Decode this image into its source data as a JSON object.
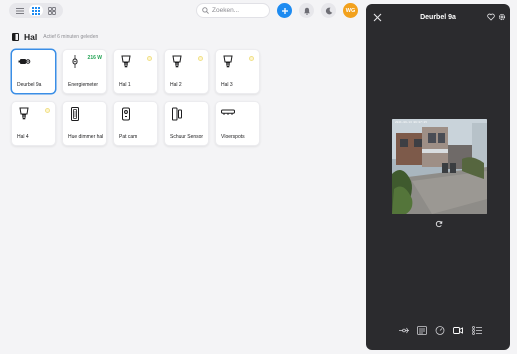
{
  "toolbar": {
    "search_placeholder": "Zoeken...",
    "avatar_initials": "WG",
    "colors": {
      "add": "#1d8bf1",
      "avatar": "#f2a11d"
    }
  },
  "room": {
    "title": "Hal",
    "subtitle": "Actief 6 minuten geleden"
  },
  "devices": [
    {
      "label": "Deurbel 9a",
      "icon": "doorbell-icon",
      "selected": true
    },
    {
      "label": "Energiemeter",
      "icon": "energy-meter-icon",
      "value": "216 W"
    },
    {
      "label": "Hal 1",
      "icon": "bulb-icon"
    },
    {
      "label": "Hal 2",
      "icon": "bulb-icon"
    },
    {
      "label": "Hal 3",
      "icon": "bulb-icon"
    },
    {
      "label": "Hal 4",
      "icon": "bulb-icon"
    },
    {
      "label": "Hue dimmer hal",
      "icon": "dimmer-switch-icon"
    },
    {
      "label": "Pat cam",
      "icon": "camera-device-icon"
    },
    {
      "label": "Schuur Sensor",
      "icon": "contact-sensor-icon"
    },
    {
      "label": "Vloerspots",
      "icon": "ceiling-spots-icon"
    }
  ],
  "panel": {
    "title": "Deurbel 9a",
    "camera_overlay": "2021-09-13 09:07:25",
    "toolbar_icons": [
      "sensor-icon",
      "list-settings-icon",
      "gauge-icon",
      "video-icon",
      "checklist-icon"
    ]
  }
}
